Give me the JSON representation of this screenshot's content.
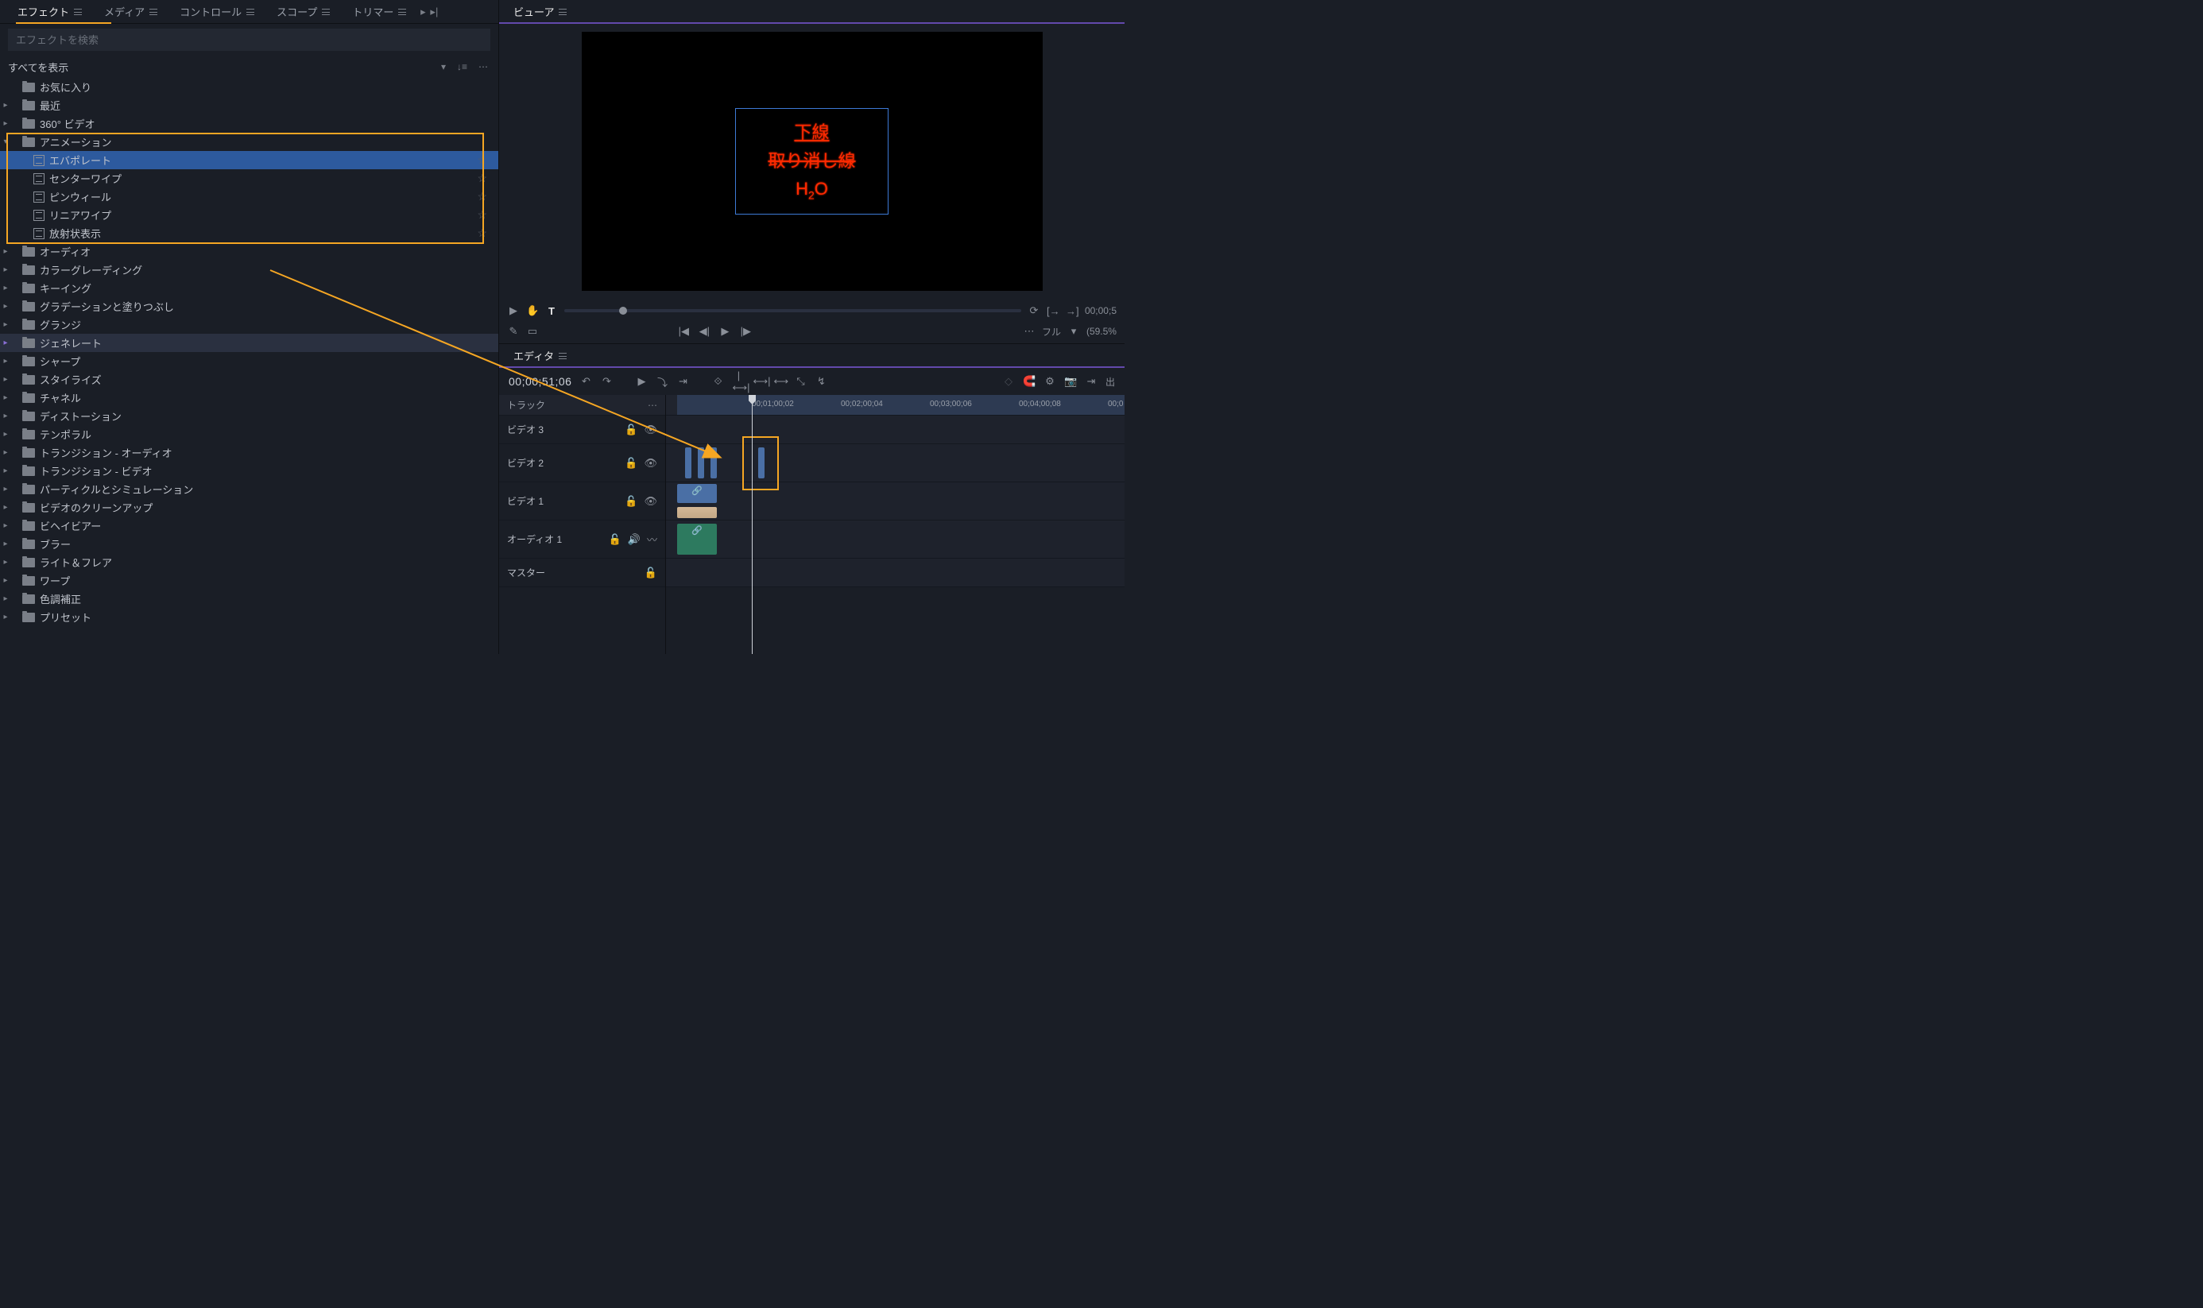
{
  "leftTabs": {
    "items": [
      "エフェクト",
      "メディア",
      "コントロール",
      "スコープ",
      "トリマー"
    ],
    "activeIndex": 0
  },
  "search": {
    "placeholder": "エフェクトを検索"
  },
  "filter": {
    "label": "すべてを表示"
  },
  "tree": {
    "simpleTop": [
      "お気に入り",
      "最近",
      "360° ビデオ"
    ],
    "animation": {
      "label": "アニメーション",
      "children": [
        "エバポレート",
        "センターワイプ",
        "ピンウィール",
        "リニアワイプ",
        "放射状表示"
      ],
      "selectedIndex": 0
    },
    "simpleBottom": [
      "オーディオ",
      "カラーグレーディング",
      "キーイング",
      "グラデーションと塗りつぶし",
      "グランジ",
      "ジェネレート",
      "シャープ",
      "スタイライズ",
      "チャネル",
      "ディストーション",
      "テンポラル",
      "トランジション - オーディオ",
      "トランジション - ビデオ",
      "パーティクルとシミュレーション",
      "ビデオのクリーンアップ",
      "ビヘイビアー",
      "ブラー",
      "ライト＆フレア",
      "ワープ",
      "色調補正",
      "プリセット"
    ],
    "highlightIndex": 5
  },
  "viewer": {
    "tab": "ビューア",
    "text": {
      "line1": "下線",
      "line2": "取り消し線",
      "line3a": "H",
      "line3sub": "2",
      "line3b": "O"
    },
    "timecode": "00;00;5",
    "zoom": "(59.5%",
    "quality": "フル"
  },
  "editor": {
    "tab": "エディタ",
    "timecode": "00;00;51;06",
    "trackHeader": "トラック",
    "ruler": [
      "00;01;00;02",
      "00;02;00;04",
      "00;03;00;06",
      "00;04;00;08",
      "00;0"
    ],
    "tracks": {
      "v3": "ビデオ 3",
      "v2": "ビデオ 2",
      "v1": "ビデオ 1",
      "a1": "オーディオ 1",
      "master": "マスター"
    },
    "exportLabel": "出"
  }
}
